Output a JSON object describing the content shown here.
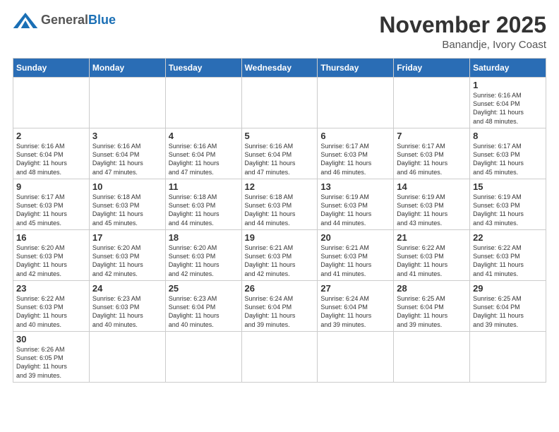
{
  "header": {
    "logo_general": "General",
    "logo_blue": "Blue",
    "month_title": "November 2025",
    "location": "Banandje, Ivory Coast"
  },
  "weekdays": [
    "Sunday",
    "Monday",
    "Tuesday",
    "Wednesday",
    "Thursday",
    "Friday",
    "Saturday"
  ],
  "weeks": [
    [
      {
        "day": "",
        "info": ""
      },
      {
        "day": "",
        "info": ""
      },
      {
        "day": "",
        "info": ""
      },
      {
        "day": "",
        "info": ""
      },
      {
        "day": "",
        "info": ""
      },
      {
        "day": "",
        "info": ""
      },
      {
        "day": "1",
        "info": "Sunrise: 6:16 AM\nSunset: 6:04 PM\nDaylight: 11 hours\nand 48 minutes."
      }
    ],
    [
      {
        "day": "2",
        "info": "Sunrise: 6:16 AM\nSunset: 6:04 PM\nDaylight: 11 hours\nand 48 minutes."
      },
      {
        "day": "3",
        "info": "Sunrise: 6:16 AM\nSunset: 6:04 PM\nDaylight: 11 hours\nand 47 minutes."
      },
      {
        "day": "4",
        "info": "Sunrise: 6:16 AM\nSunset: 6:04 PM\nDaylight: 11 hours\nand 47 minutes."
      },
      {
        "day": "5",
        "info": "Sunrise: 6:16 AM\nSunset: 6:04 PM\nDaylight: 11 hours\nand 47 minutes."
      },
      {
        "day": "6",
        "info": "Sunrise: 6:17 AM\nSunset: 6:03 PM\nDaylight: 11 hours\nand 46 minutes."
      },
      {
        "day": "7",
        "info": "Sunrise: 6:17 AM\nSunset: 6:03 PM\nDaylight: 11 hours\nand 46 minutes."
      },
      {
        "day": "8",
        "info": "Sunrise: 6:17 AM\nSunset: 6:03 PM\nDaylight: 11 hours\nand 45 minutes."
      }
    ],
    [
      {
        "day": "9",
        "info": "Sunrise: 6:17 AM\nSunset: 6:03 PM\nDaylight: 11 hours\nand 45 minutes."
      },
      {
        "day": "10",
        "info": "Sunrise: 6:18 AM\nSunset: 6:03 PM\nDaylight: 11 hours\nand 45 minutes."
      },
      {
        "day": "11",
        "info": "Sunrise: 6:18 AM\nSunset: 6:03 PM\nDaylight: 11 hours\nand 44 minutes."
      },
      {
        "day": "12",
        "info": "Sunrise: 6:18 AM\nSunset: 6:03 PM\nDaylight: 11 hours\nand 44 minutes."
      },
      {
        "day": "13",
        "info": "Sunrise: 6:19 AM\nSunset: 6:03 PM\nDaylight: 11 hours\nand 44 minutes."
      },
      {
        "day": "14",
        "info": "Sunrise: 6:19 AM\nSunset: 6:03 PM\nDaylight: 11 hours\nand 43 minutes."
      },
      {
        "day": "15",
        "info": "Sunrise: 6:19 AM\nSunset: 6:03 PM\nDaylight: 11 hours\nand 43 minutes."
      }
    ],
    [
      {
        "day": "16",
        "info": "Sunrise: 6:20 AM\nSunset: 6:03 PM\nDaylight: 11 hours\nand 42 minutes."
      },
      {
        "day": "17",
        "info": "Sunrise: 6:20 AM\nSunset: 6:03 PM\nDaylight: 11 hours\nand 42 minutes."
      },
      {
        "day": "18",
        "info": "Sunrise: 6:20 AM\nSunset: 6:03 PM\nDaylight: 11 hours\nand 42 minutes."
      },
      {
        "day": "19",
        "info": "Sunrise: 6:21 AM\nSunset: 6:03 PM\nDaylight: 11 hours\nand 42 minutes."
      },
      {
        "day": "20",
        "info": "Sunrise: 6:21 AM\nSunset: 6:03 PM\nDaylight: 11 hours\nand 41 minutes."
      },
      {
        "day": "21",
        "info": "Sunrise: 6:22 AM\nSunset: 6:03 PM\nDaylight: 11 hours\nand 41 minutes."
      },
      {
        "day": "22",
        "info": "Sunrise: 6:22 AM\nSunset: 6:03 PM\nDaylight: 11 hours\nand 41 minutes."
      }
    ],
    [
      {
        "day": "23",
        "info": "Sunrise: 6:22 AM\nSunset: 6:03 PM\nDaylight: 11 hours\nand 40 minutes."
      },
      {
        "day": "24",
        "info": "Sunrise: 6:23 AM\nSunset: 6:03 PM\nDaylight: 11 hours\nand 40 minutes."
      },
      {
        "day": "25",
        "info": "Sunrise: 6:23 AM\nSunset: 6:04 PM\nDaylight: 11 hours\nand 40 minutes."
      },
      {
        "day": "26",
        "info": "Sunrise: 6:24 AM\nSunset: 6:04 PM\nDaylight: 11 hours\nand 39 minutes."
      },
      {
        "day": "27",
        "info": "Sunrise: 6:24 AM\nSunset: 6:04 PM\nDaylight: 11 hours\nand 39 minutes."
      },
      {
        "day": "28",
        "info": "Sunrise: 6:25 AM\nSunset: 6:04 PM\nDaylight: 11 hours\nand 39 minutes."
      },
      {
        "day": "29",
        "info": "Sunrise: 6:25 AM\nSunset: 6:04 PM\nDaylight: 11 hours\nand 39 minutes."
      }
    ],
    [
      {
        "day": "30",
        "info": "Sunrise: 6:26 AM\nSunset: 6:05 PM\nDaylight: 11 hours\nand 39 minutes."
      },
      {
        "day": "",
        "info": ""
      },
      {
        "day": "",
        "info": ""
      },
      {
        "day": "",
        "info": ""
      },
      {
        "day": "",
        "info": ""
      },
      {
        "day": "",
        "info": ""
      },
      {
        "day": "",
        "info": ""
      }
    ]
  ]
}
